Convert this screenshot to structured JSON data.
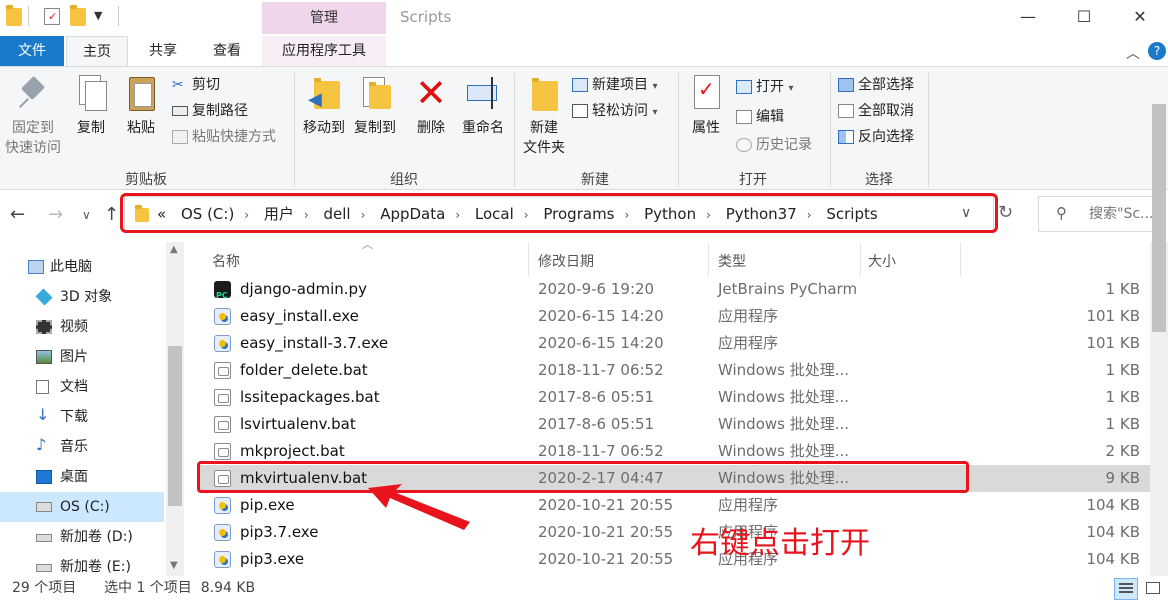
{
  "title_bar": {
    "context_tab_header": "管理",
    "window_title": "Scripts",
    "minimize_glyph": "—",
    "maximize_glyph": "☐",
    "close_glyph": "✕"
  },
  "tabs": [
    {
      "label": "文件"
    },
    {
      "label": "主页"
    },
    {
      "label": "共享"
    },
    {
      "label": "查看"
    },
    {
      "label": "应用程序工具"
    }
  ],
  "ribbon": {
    "clipboard": {
      "label": "剪贴板",
      "pin": [
        "固定到",
        "快速访问"
      ],
      "copy": "复制",
      "paste": "粘贴",
      "cut": "剪切",
      "copy_path": "复制路径",
      "paste_shortcut": "粘贴快捷方式"
    },
    "organize": {
      "label": "组织",
      "move_to": "移动到",
      "copy_to": "复制到",
      "delete": "删除",
      "rename": "重命名"
    },
    "new": {
      "label": "新建",
      "new_folder": [
        "新建",
        "文件夹"
      ],
      "new_item": "新建项目",
      "easy_access": "轻松访问"
    },
    "open": {
      "label": "打开",
      "properties": "属性",
      "open": "打开",
      "edit": "编辑",
      "history": "历史记录"
    },
    "select": {
      "label": "选择",
      "select_all": "全部选择",
      "select_none": "全部取消",
      "invert": "反向选择"
    }
  },
  "address": {
    "overflow": "«",
    "crumbs": [
      "OS (C:)",
      "用户",
      "dell",
      "AppData",
      "Local",
      "Programs",
      "Python",
      "Python37",
      "Scripts"
    ],
    "search_placeholder": "搜索\"Sc..."
  },
  "nav_pane": {
    "items": [
      {
        "label": "此电脑",
        "icon": "computer-icon"
      },
      {
        "label": "3D 对象",
        "icon": "cube-icon"
      },
      {
        "label": "视频",
        "icon": "video-icon"
      },
      {
        "label": "图片",
        "icon": "picture-icon"
      },
      {
        "label": "文档",
        "icon": "document-icon"
      },
      {
        "label": "下载",
        "icon": "download-icon"
      },
      {
        "label": "音乐",
        "icon": "music-icon"
      },
      {
        "label": "桌面",
        "icon": "desktop-icon"
      },
      {
        "label": "OS (C:)",
        "icon": "drive-icon"
      },
      {
        "label": "新加卷 (D:)",
        "icon": "drive-icon"
      },
      {
        "label": "新加卷 (E:)",
        "icon": "drive-icon"
      }
    ]
  },
  "file_list": {
    "columns": {
      "name": "名称",
      "date": "修改日期",
      "type": "类型",
      "size": "大小"
    },
    "rows": [
      {
        "name": "django-admin.py",
        "date": "2020-9-6 19:20",
        "type": "JetBrains PyCharm",
        "size": "1 KB",
        "icon": "pycharm-icon"
      },
      {
        "name": "easy_install.exe",
        "date": "2020-6-15 14:20",
        "type": "应用程序",
        "size": "101 KB",
        "icon": "exe-icon"
      },
      {
        "name": "easy_install-3.7.exe",
        "date": "2020-6-15 14:20",
        "type": "应用程序",
        "size": "101 KB",
        "icon": "exe-icon"
      },
      {
        "name": "folder_delete.bat",
        "date": "2018-11-7 06:52",
        "type": "Windows 批处理...",
        "size": "1 KB",
        "icon": "bat-icon"
      },
      {
        "name": "lssitepackages.bat",
        "date": "2017-8-6 05:51",
        "type": "Windows 批处理...",
        "size": "1 KB",
        "icon": "bat-icon"
      },
      {
        "name": "lsvirtualenv.bat",
        "date": "2017-8-6 05:51",
        "type": "Windows 批处理...",
        "size": "1 KB",
        "icon": "bat-icon"
      },
      {
        "name": "mkproject.bat",
        "date": "2018-11-7 06:52",
        "type": "Windows 批处理...",
        "size": "2 KB",
        "icon": "bat-icon"
      },
      {
        "name": "mkvirtualenv.bat",
        "date": "2020-2-17 04:47",
        "type": "Windows 批处理...",
        "size": "9 KB",
        "icon": "bat-icon",
        "selected": true
      },
      {
        "name": "pip.exe",
        "date": "2020-10-21 20:55",
        "type": "应用程序",
        "size": "104 KB",
        "icon": "exe-icon"
      },
      {
        "name": "pip3.7.exe",
        "date": "2020-10-21 20:55",
        "type": "应用程序",
        "size": "104 KB",
        "icon": "exe-icon"
      },
      {
        "name": "pip3.exe",
        "date": "2020-10-21 20:55",
        "type": "应用程序",
        "size": "104 KB",
        "icon": "exe-icon"
      }
    ]
  },
  "status_bar": {
    "item_count": "29 个项目",
    "selection": "选中 1 个项目  8.94 KB"
  },
  "annotation": {
    "callout": "右键点击打开",
    "color": "#e8131c"
  },
  "colors": {
    "accent": "#1979ca",
    "selection_nav": "#cce8ff",
    "context_tab": "#f0d6ec"
  }
}
